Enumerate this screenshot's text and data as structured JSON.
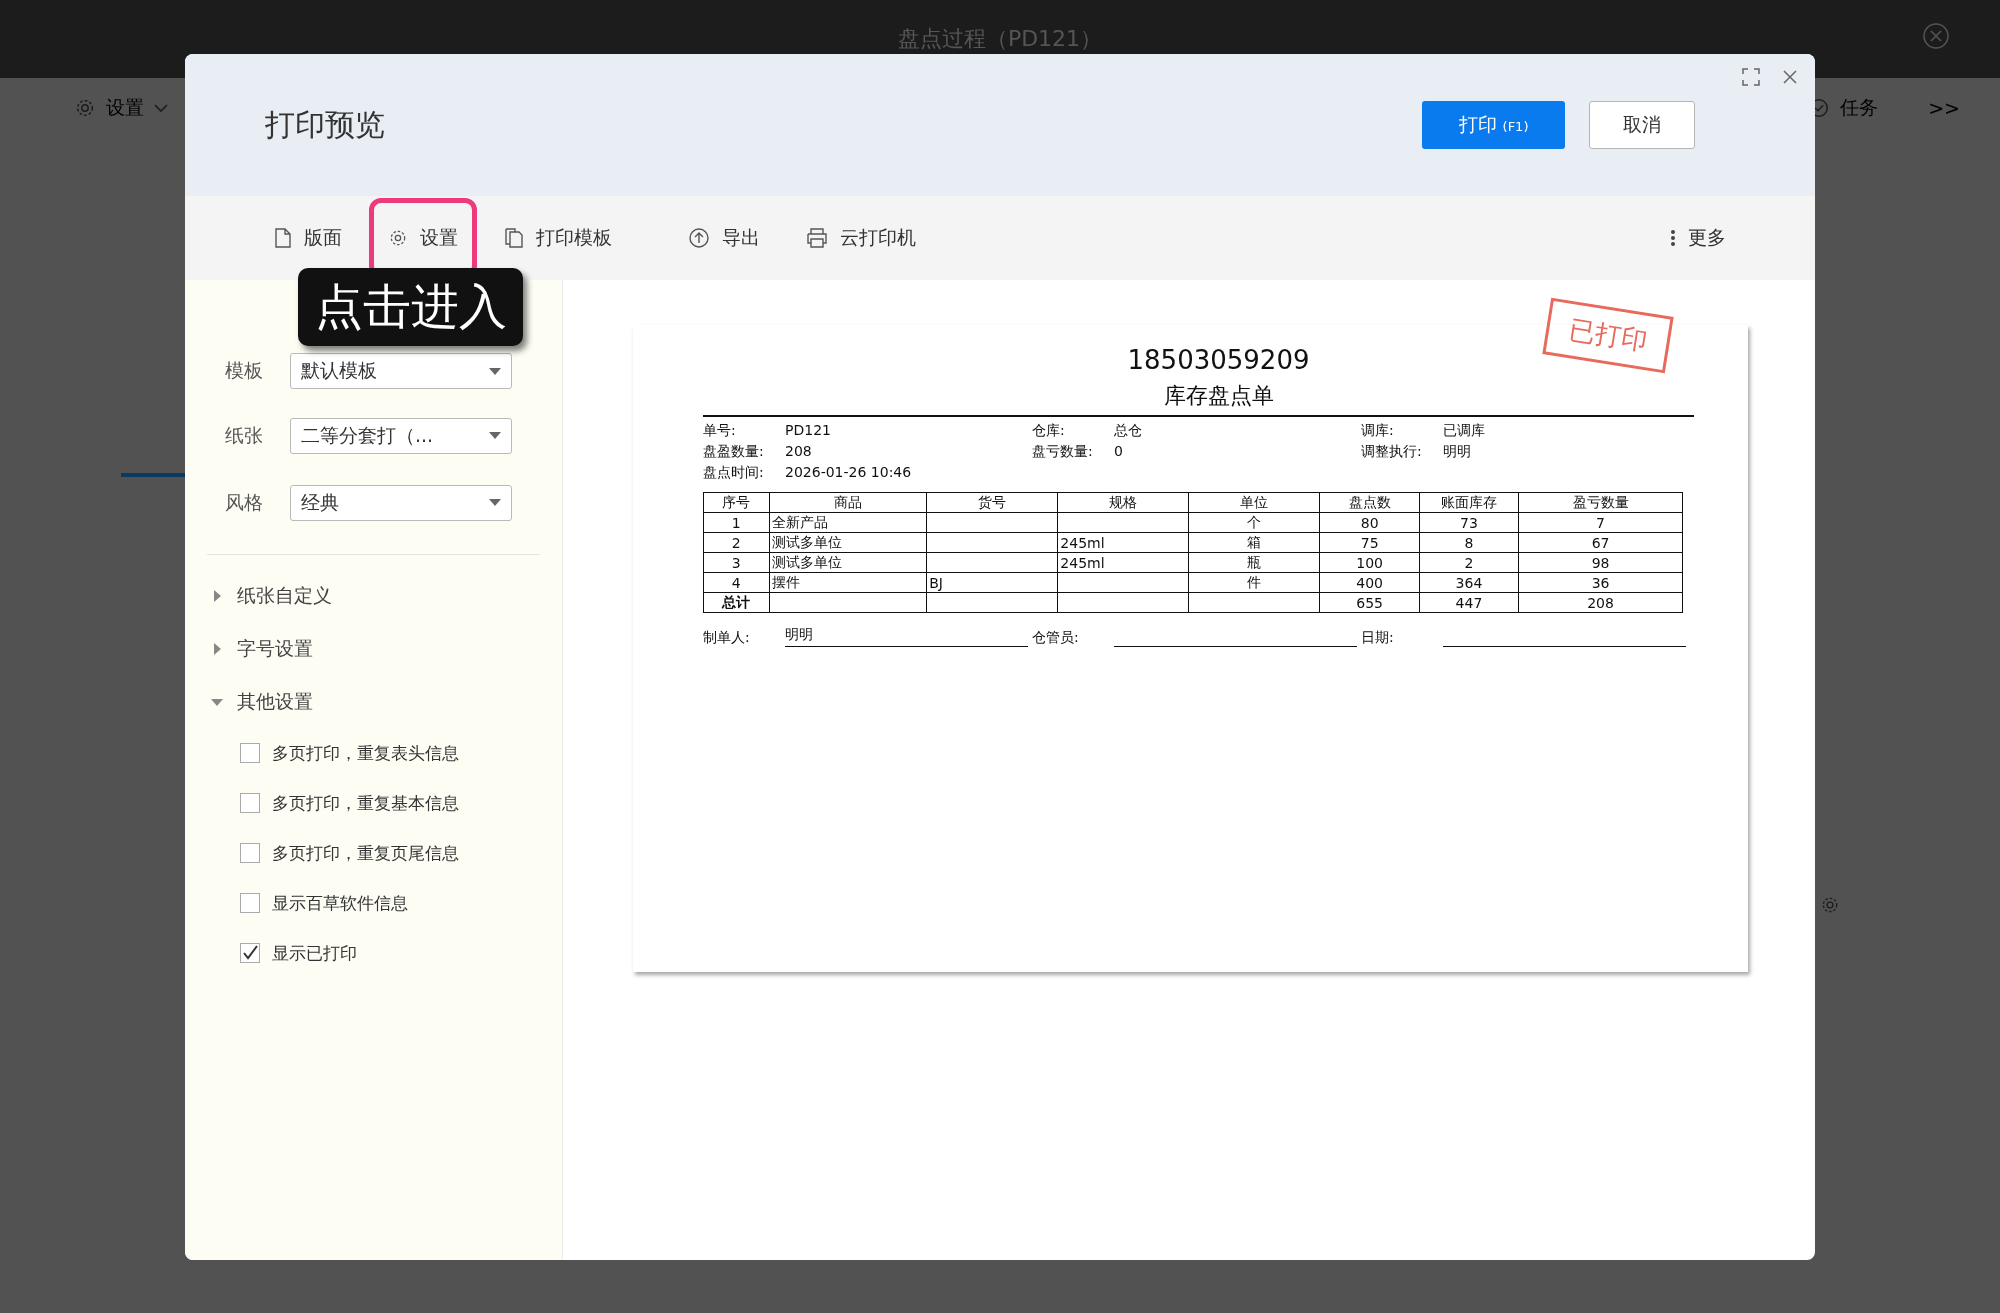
{
  "app_bar": {
    "title": "盘点过程（PD121）"
  },
  "background": {
    "toolbar_left": "设置",
    "toolbar_right": "任务",
    "expand": ">>"
  },
  "dialog": {
    "title": "打印预览",
    "buttons": [
      {
        "label": "打印",
        "shortcut": "(F1)",
        "kind": "primary"
      },
      {
        "label": "取消",
        "kind": "secondary"
      }
    ]
  },
  "toolbar": {
    "items": [
      {
        "label": "版面",
        "highlighted": false
      },
      {
        "label": "设置",
        "highlighted": true
      },
      {
        "label": "打印模板",
        "highlighted": false
      },
      {
        "label": "导出",
        "highlighted": false
      },
      {
        "label": "云打印机",
        "highlighted": false
      }
    ],
    "more": "更多"
  },
  "callout": {
    "text": "点击进入"
  },
  "settings": {
    "fields": [
      {
        "label": "模板",
        "value": "默认模板"
      },
      {
        "label": "纸张",
        "value": "二等分套打（..."
      },
      {
        "label": "风格",
        "value": "经典"
      }
    ],
    "sections": [
      {
        "label": "纸张自定义",
        "expanded": false
      },
      {
        "label": "字号设置",
        "expanded": false
      },
      {
        "label": "其他设置",
        "expanded": true,
        "options": [
          {
            "label": "多页打印，重复表头信息",
            "checked": false
          },
          {
            "label": "多页打印，重复基本信息",
            "checked": false
          },
          {
            "label": "多页打印，重复页尾信息",
            "checked": false
          },
          {
            "label": "显示百草软件信息",
            "checked": false
          },
          {
            "label": "显示已打印",
            "checked": true
          }
        ]
      }
    ]
  },
  "document": {
    "stamp": "已打印",
    "number": "18503059209",
    "title": "库存盘点单",
    "info": [
      [
        {
          "label": "单号:",
          "value": "PD121"
        },
        {
          "label": "仓库:",
          "value": "总仓"
        },
        {
          "label": "调库:",
          "value": "已调库"
        }
      ],
      [
        {
          "label": "盘盈数量:",
          "value": "208"
        },
        {
          "label": "盘亏数量:",
          "value": "0"
        },
        {
          "label": "调整执行:",
          "value": "明明"
        }
      ],
      [
        {
          "label": "盘点时间:",
          "value": "2026-01-26 10:46"
        }
      ]
    ],
    "columns": [
      "序号",
      "商品",
      "货号",
      "规格",
      "单位",
      "盘点数",
      "账面库存",
      "盈亏数量"
    ],
    "rows": [
      {
        "no": "1",
        "product": "全新产品",
        "unit": "个",
        "count": "80",
        "book": "73",
        "diff": "7"
      },
      {
        "no": "2",
        "product": "测试多单位",
        "spec": "245ml",
        "unit": "箱",
        "count": "75",
        "book": "8",
        "diff": "67"
      },
      {
        "no": "3",
        "product": "测试多单位",
        "spec": "245ml",
        "unit": "瓶",
        "count": "100",
        "book": "2",
        "diff": "98"
      },
      {
        "no": "4",
        "product": "摆件",
        "code": "BJ",
        "unit": "件",
        "count": "400",
        "book": "364",
        "diff": "36"
      }
    ],
    "total": {
      "no": "总计",
      "count": "655",
      "book": "447",
      "diff": "208"
    },
    "footer": [
      {
        "label": "制单人:",
        "value": "明明"
      },
      {
        "label": "仓管员:"
      },
      {
        "label": "日期:"
      }
    ]
  }
}
